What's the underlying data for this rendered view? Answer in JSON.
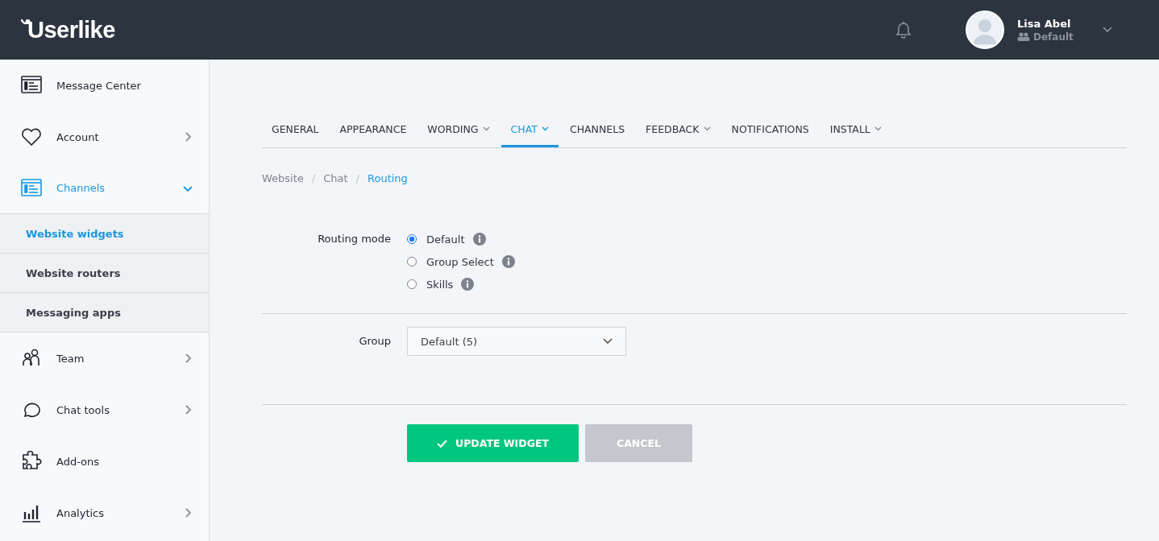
{
  "header": {
    "logo": "Userlike",
    "user": {
      "name": "Lisa Abel",
      "group": "Default"
    }
  },
  "sidebar": {
    "items": [
      {
        "label": "Message Center",
        "selected": false
      },
      {
        "label": "Account",
        "selected": false,
        "expanded": false
      },
      {
        "label": "Channels",
        "selected": true,
        "expanded": true,
        "children": [
          {
            "label": "Website widgets",
            "selected": true
          },
          {
            "label": "Website routers",
            "selected": false
          },
          {
            "label": "Messaging apps",
            "selected": false
          }
        ]
      },
      {
        "label": "Team",
        "selected": false,
        "expanded": false
      },
      {
        "label": "Chat tools",
        "selected": false,
        "expanded": false
      },
      {
        "label": "Add-ons",
        "selected": false
      },
      {
        "label": "Analytics",
        "selected": false,
        "expanded": false
      }
    ]
  },
  "tabs": [
    {
      "label": "GENERAL",
      "selected": false,
      "dropdown": false
    },
    {
      "label": "APPEARANCE",
      "selected": false,
      "dropdown": false
    },
    {
      "label": "WORDING",
      "selected": false,
      "dropdown": true
    },
    {
      "label": "CHAT",
      "selected": true,
      "dropdown": true
    },
    {
      "label": "CHANNELS",
      "selected": false,
      "dropdown": false
    },
    {
      "label": "FEEDBACK",
      "selected": false,
      "dropdown": true
    },
    {
      "label": "NOTIFICATIONS",
      "selected": false,
      "dropdown": false
    },
    {
      "label": "INSTALL",
      "selected": false,
      "dropdown": true
    }
  ],
  "breadcrumb": [
    {
      "label": "Website",
      "selected": false
    },
    {
      "separator": "/",
      "label": "Chat",
      "selected": false
    },
    {
      "separator": "/",
      "label": "Routing",
      "selected": true
    }
  ],
  "routing_mode": {
    "label": "Routing mode",
    "options": [
      {
        "label": "Default",
        "selected": true
      },
      {
        "label": "Group Select",
        "selected": false
      },
      {
        "label": "Skills",
        "selected": false
      }
    ]
  },
  "group": {
    "label": "Group",
    "value": "Default (5)"
  },
  "buttons": [
    {
      "label": "UPDATE WIDGET",
      "kind": "primary"
    },
    {
      "label": "CANCEL",
      "kind": "secondary"
    }
  ]
}
